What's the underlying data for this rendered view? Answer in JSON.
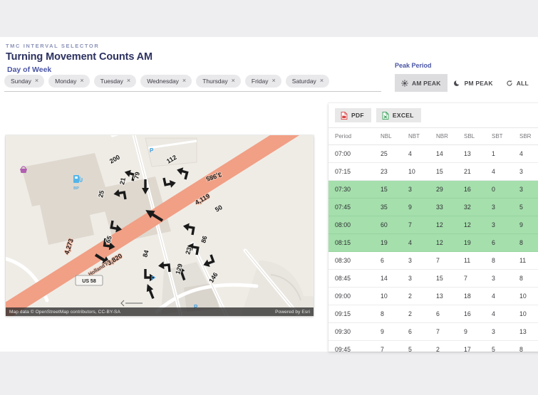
{
  "header": {
    "eyebrow": "TMC INTERVAL SELECTOR",
    "title": "Turning Movement Counts AM",
    "subtitle": "Day of Week"
  },
  "day_chips": [
    {
      "label": "Sunday",
      "remove": "×"
    },
    {
      "label": "Monday",
      "remove": "×"
    },
    {
      "label": "Tuesday",
      "remove": "×"
    },
    {
      "label": "Wednesday",
      "remove": "×"
    },
    {
      "label": "Thursday",
      "remove": "×"
    },
    {
      "label": "Friday",
      "remove": "×"
    },
    {
      "label": "Saturday",
      "remove": "×"
    }
  ],
  "peak_period": {
    "label": "Peak Period",
    "selected": "AM PEAK",
    "options": [
      {
        "label": "AM PEAK",
        "icon": "sun-icon",
        "selected": true
      },
      {
        "label": "PM PEAK",
        "icon": "moon-icon",
        "selected": false
      },
      {
        "label": "ALL",
        "icon": "refresh-icon",
        "selected": false
      }
    ]
  },
  "map": {
    "road_name": "Holland Road",
    "route_shield": "US 58",
    "poi_labels": [
      "BP"
    ],
    "parking_markers": [
      "P",
      "P",
      "P"
    ],
    "attribution_left": "Map data © OpenStreetMap contributors, CC-BY-SA",
    "attribution_right": "Powered by Esri",
    "volume_labels": [
      {
        "value": "200"
      },
      {
        "value": "79"
      },
      {
        "value": "21"
      },
      {
        "value": "25"
      },
      {
        "value": "112"
      },
      {
        "value": "3,985"
      },
      {
        "value": "4,119"
      },
      {
        "value": "50"
      },
      {
        "value": "65"
      },
      {
        "value": "3,820"
      },
      {
        "value": "84"
      },
      {
        "value": "23"
      },
      {
        "value": "86"
      },
      {
        "value": "129"
      },
      {
        "value": "146"
      },
      {
        "value": "4,273"
      }
    ]
  },
  "table": {
    "export_buttons": [
      {
        "label": "PDF",
        "icon": "pdf-file-icon"
      },
      {
        "label": "EXCEL",
        "icon": "excel-file-icon"
      }
    ],
    "columns": [
      "Period",
      "NBL",
      "NBT",
      "NBR",
      "SBL",
      "SBT",
      "SBR"
    ],
    "highlight_color": "#a5dfac",
    "rows": [
      {
        "period": "07:00",
        "values": [
          "25",
          "4",
          "14",
          "13",
          "1",
          "4"
        ],
        "highlight": false
      },
      {
        "period": "07:15",
        "values": [
          "23",
          "10",
          "15",
          "21",
          "4",
          "3"
        ],
        "highlight": false
      },
      {
        "period": "07:30",
        "values": [
          "15",
          "3",
          "29",
          "16",
          "0",
          "3"
        ],
        "highlight": true
      },
      {
        "period": "07:45",
        "values": [
          "35",
          "9",
          "33",
          "32",
          "3",
          "5"
        ],
        "highlight": true
      },
      {
        "period": "08:00",
        "values": [
          "60",
          "7",
          "12",
          "12",
          "3",
          "9"
        ],
        "highlight": true
      },
      {
        "period": "08:15",
        "values": [
          "19",
          "4",
          "12",
          "19",
          "6",
          "8"
        ],
        "highlight": true
      },
      {
        "period": "08:30",
        "values": [
          "6",
          "3",
          "7",
          "11",
          "8",
          "11"
        ],
        "highlight": false
      },
      {
        "period": "08:45",
        "values": [
          "14",
          "3",
          "15",
          "7",
          "3",
          "8"
        ],
        "highlight": false
      },
      {
        "period": "09:00",
        "values": [
          "10",
          "2",
          "13",
          "18",
          "4",
          "10"
        ],
        "highlight": false
      },
      {
        "period": "09:15",
        "values": [
          "8",
          "2",
          "6",
          "16",
          "4",
          "10"
        ],
        "highlight": false
      },
      {
        "period": "09:30",
        "values": [
          "9",
          "6",
          "7",
          "9",
          "3",
          "13"
        ],
        "highlight": false
      },
      {
        "period": "09:45",
        "values": [
          "7",
          "5",
          "2",
          "17",
          "5",
          "8"
        ],
        "highlight": false
      }
    ]
  },
  "colors": {
    "accent": "#4a55a5",
    "title": "#2c3160",
    "page_bg": "#eeeef0",
    "highlight_green": "#a5dfac",
    "road_highlight": "#f4a58b",
    "pdf_red": "#d94040",
    "excel_green": "#2e9e52"
  }
}
